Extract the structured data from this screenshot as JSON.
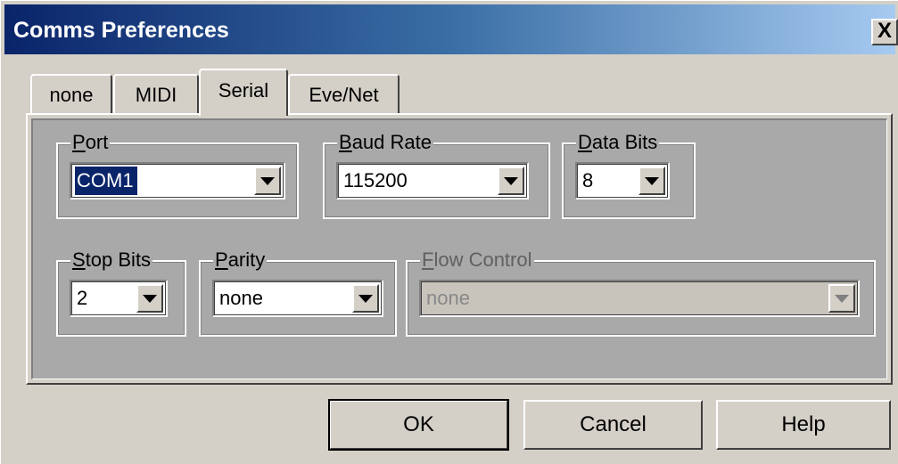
{
  "window": {
    "title": "Comms Preferences",
    "close_label": "X"
  },
  "tabs": [
    {
      "label": "none",
      "selected": false
    },
    {
      "label": "MIDI",
      "selected": false
    },
    {
      "label": "Serial",
      "selected": true
    },
    {
      "label": "Eve/Net",
      "selected": false
    }
  ],
  "serial": {
    "port": {
      "label": "Port",
      "value": "COM1",
      "enabled": true,
      "focused": true
    },
    "baud_rate": {
      "label": "Baud Rate",
      "value": "115200",
      "enabled": true
    },
    "data_bits": {
      "label": "Data Bits",
      "value": "8",
      "enabled": true
    },
    "stop_bits": {
      "label": "Stop Bits",
      "value": "2",
      "enabled": true
    },
    "parity": {
      "label": "Parity",
      "value": "none",
      "enabled": true
    },
    "flow_control": {
      "label": "Flow Control",
      "value": "none",
      "enabled": false
    }
  },
  "buttons": {
    "ok": "OK",
    "cancel": "Cancel",
    "help": "Help"
  },
  "colors": {
    "titlebar_start": "#0a246a",
    "titlebar_end": "#a6caf0",
    "dialog_face": "#d4d0c8",
    "panel_face": "#a9a9a9",
    "selection": "#0a246a"
  }
}
